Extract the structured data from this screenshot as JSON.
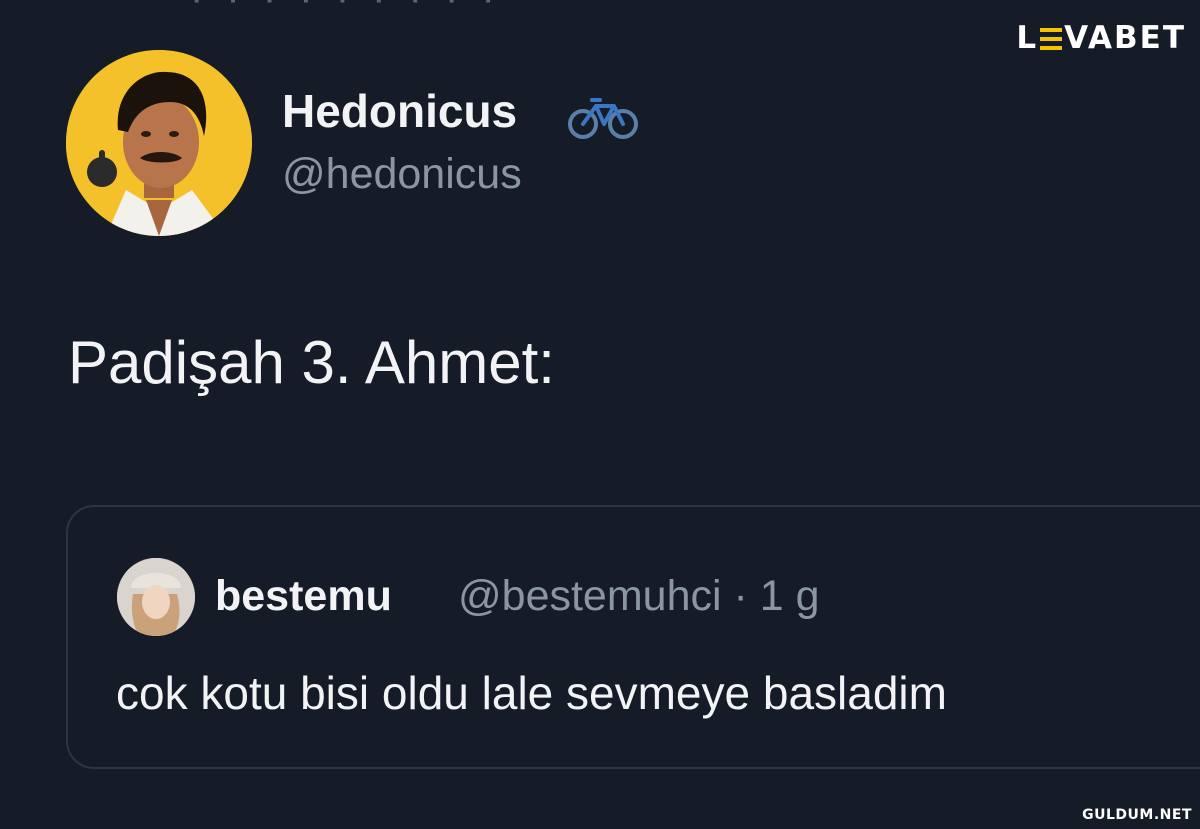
{
  "header": {
    "brand_logo_text": "LEVABET"
  },
  "tweet": {
    "author_name": "Hedonicus",
    "author_handle": "@hedonicus",
    "name_emoji_icon": "bicycle-icon",
    "text": "Padişah 3. Ahmet:"
  },
  "quoted_tweet": {
    "author_name": "bestemu",
    "author_handle": "@bestemuhci",
    "separator": "·",
    "time": "1 g",
    "text": "cok kotu bisi oldu lale sevmeye basladim"
  },
  "footer": {
    "watermark": "GULDUM.NET"
  },
  "colors": {
    "background": "#151c28",
    "primary_text": "#f2f3f5",
    "secondary_text": "#8b96a3",
    "border": "#2c3542",
    "avatar_bg": "#f4c12a",
    "brand_accent": "#f5c400"
  }
}
